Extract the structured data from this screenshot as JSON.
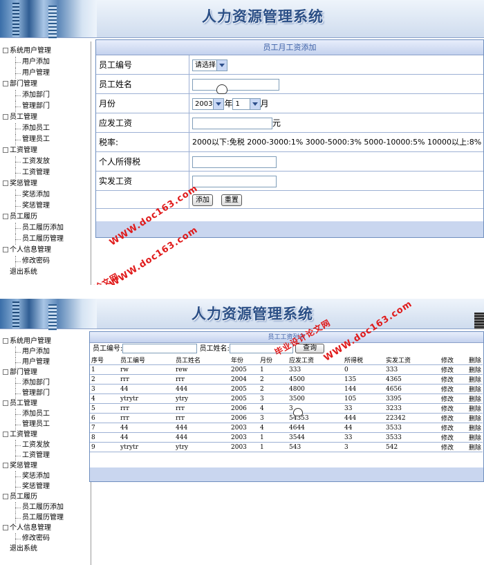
{
  "app": {
    "title": "人力资源管理系统"
  },
  "sidebar": {
    "items": [
      {
        "label": "系统用户管理",
        "level": "group"
      },
      {
        "label": "用户添加",
        "level": "sub"
      },
      {
        "label": "用户管理",
        "level": "sub"
      },
      {
        "label": "部门管理",
        "level": "group"
      },
      {
        "label": "添加部门",
        "level": "sub"
      },
      {
        "label": "管理部门",
        "level": "sub"
      },
      {
        "label": "员工管理",
        "level": "group"
      },
      {
        "label": "添加员工",
        "level": "sub"
      },
      {
        "label": "管理员工",
        "level": "sub"
      },
      {
        "label": "工资管理",
        "level": "group"
      },
      {
        "label": "工资发放",
        "level": "sub"
      },
      {
        "label": "工资管理",
        "level": "sub"
      },
      {
        "label": "奖惩管理",
        "level": "group"
      },
      {
        "label": "奖惩添加",
        "level": "sub"
      },
      {
        "label": "奖惩管理",
        "level": "sub"
      },
      {
        "label": "员工履历",
        "level": "group"
      },
      {
        "label": "员工履历添加",
        "level": "sub"
      },
      {
        "label": "员工履历管理",
        "level": "sub"
      },
      {
        "label": "个人信息管理",
        "level": "group"
      },
      {
        "label": "修改密码",
        "level": "sub"
      },
      {
        "label": "退出系统",
        "level": "leaf"
      }
    ]
  },
  "form": {
    "title": "员工月工资添加",
    "employee_id_label": "员工编号",
    "employee_id_select": "请选择",
    "employee_name_label": "员工姓名",
    "month_label": "月份",
    "year_value": "2003",
    "year_suffix": "年",
    "month_value": "1",
    "month_suffix": "月",
    "payable_label": "应发工资",
    "payable_unit": "元",
    "tax_rate_label": "税率:",
    "tax_rate_text": "2000以下:免税  2000-3000:1% 3000-5000:3% 5000-10000:5% 10000以上:8%",
    "income_tax_label": "个人所得税",
    "actual_pay_label": "实发工资",
    "add_button": "添加",
    "reset_button": "重置"
  },
  "list": {
    "title": "员工工资列表",
    "search_id_label": "员工编号:",
    "search_name_label": "员工姓名:",
    "search_button": "查询",
    "columns": [
      "序号",
      "员工编号",
      "员工姓名",
      "年份",
      "月份",
      "应发工资",
      "所得税",
      "实发工资",
      "修改",
      "删除"
    ],
    "rows": [
      [
        "1",
        "rw",
        "rew",
        "2005",
        "1",
        "333",
        "0",
        "333",
        "修改",
        "删除"
      ],
      [
        "2",
        "rrr",
        "rrr",
        "2004",
        "2",
        "4500",
        "135",
        "4365",
        "修改",
        "删除"
      ],
      [
        "3",
        "44",
        "444",
        "2005",
        "2",
        "4800",
        "144",
        "4656",
        "修改",
        "删除"
      ],
      [
        "4",
        "ytrytr",
        "ytry",
        "2005",
        "3",
        "3500",
        "105",
        "3395",
        "修改",
        "删除"
      ],
      [
        "5",
        "rrr",
        "rrr",
        "2006",
        "4",
        "3",
        "33",
        "3233",
        "修改",
        "删除"
      ],
      [
        "6",
        "rrr",
        "rrr",
        "2006",
        "3",
        "54353",
        "444",
        "22342",
        "修改",
        "删除"
      ],
      [
        "7",
        "44",
        "444",
        "2003",
        "4",
        "4644",
        "44",
        "3533",
        "修改",
        "删除"
      ],
      [
        "8",
        "44",
        "444",
        "2003",
        "1",
        "3544",
        "33",
        "3533",
        "修改",
        "删除"
      ],
      [
        "9",
        "ytrytr",
        "ytry",
        "2003",
        "1",
        "543",
        "3",
        "542",
        "修改",
        "删除"
      ]
    ]
  },
  "watermarks": {
    "site": "WWW.doc163.com",
    "brand": "毕业设计论文网"
  },
  "colors": {
    "title": "#2b4f86",
    "border": "#6f8fbf",
    "watermark": "#e01a1a"
  }
}
